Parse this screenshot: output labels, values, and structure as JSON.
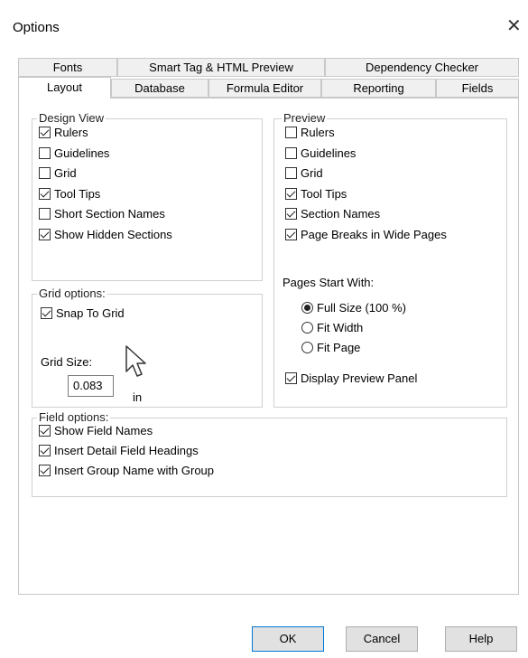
{
  "window": {
    "title": "Options",
    "close_glyph": "✕"
  },
  "tabs": {
    "row1": [
      "Fonts",
      "Smart Tag & HTML Preview",
      "Dependency Checker"
    ],
    "row2": [
      "Layout",
      "Database",
      "Formula Editor",
      "Reporting",
      "Fields"
    ],
    "active": "Layout"
  },
  "design_view": {
    "legend": "Design View",
    "items": [
      {
        "label": "Rulers",
        "checked": true
      },
      {
        "label": "Guidelines",
        "checked": false
      },
      {
        "label": "Grid",
        "checked": false
      },
      {
        "label": "Tool Tips",
        "checked": true
      },
      {
        "label": "Short Section Names",
        "checked": false
      },
      {
        "label": "Show Hidden Sections",
        "checked": true
      }
    ]
  },
  "preview": {
    "legend": "Preview",
    "items": [
      {
        "label": "Rulers",
        "checked": false
      },
      {
        "label": "Guidelines",
        "checked": false
      },
      {
        "label": "Grid",
        "checked": false
      },
      {
        "label": "Tool Tips",
        "checked": true
      },
      {
        "label": "Section Names",
        "checked": true
      },
      {
        "label": "Page Breaks in Wide Pages",
        "checked": true
      }
    ],
    "pages_start_label": "Pages Start With:",
    "radios": [
      {
        "label": "Full Size (100 %)",
        "selected": true
      },
      {
        "label": "Fit Width",
        "selected": false
      },
      {
        "label": "Fit Page",
        "selected": false
      }
    ],
    "display_panel": {
      "label": "Display Preview Panel",
      "checked": true
    }
  },
  "grid_options": {
    "legend": "Grid options:",
    "snap": {
      "label": "Snap To Grid",
      "checked": true
    },
    "grid_size_label": "Grid Size:",
    "grid_size_value": "0.083",
    "unit": "in"
  },
  "field_options": {
    "legend": "Field options:",
    "items": [
      {
        "label": "Show Field Names",
        "checked": true
      },
      {
        "label": "Insert Detail Field Headings",
        "checked": true
      },
      {
        "label": "Insert Group Name with Group",
        "checked": true
      }
    ]
  },
  "buttons": {
    "ok": "OK",
    "cancel": "Cancel",
    "help": "Help"
  },
  "colors": {
    "accent": "#0078d7",
    "button_bg": "#e1e1e1",
    "tab_bg": "#f0f0f0"
  }
}
